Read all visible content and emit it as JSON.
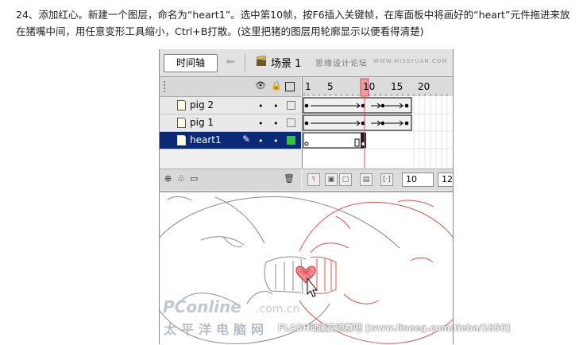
{
  "instruction_text": "24、添加红心。新建一个图层，命名为“heart1”。选中第10帧，按F6插入关键帧，在库面板中将画好的“heart”元件拖进来放在猪嘴中间，用任意变形工具缩小，Ctrl+B打散。(这里把猪的图层用轮廓显示以便看得清楚)",
  "toolbar": {
    "timeline_button": "时间轴",
    "scene_label": "场景 1",
    "forum_text": "思缘设计论坛",
    "site_text": "WWW.MISSYUAN.COM"
  },
  "timeline": {
    "frame_numbers": [
      "1",
      "5",
      "10",
      "15",
      "20"
    ],
    "layers": [
      {
        "name": "pig 2",
        "selected": false,
        "outline_color": "#e05050"
      },
      {
        "name": "pig 1",
        "selected": false,
        "outline_color": "#8a8a8a"
      },
      {
        "name": "heart1",
        "selected": true,
        "outline_color": "#2ec82e"
      }
    ],
    "current_frame": "10",
    "frame_rate": "12"
  },
  "watermark": {
    "brand": "PConline",
    "domain_suffix": ".com.cn",
    "brand_cn": "太平洋电脑网",
    "credit": "FLASH动画交流群吧 [www.lineeg.com/tieba/1856]"
  },
  "colors": {
    "selected_layer": "#0a2a78",
    "playhead": "#e05560",
    "pig_left_outline": "#8a8a8a",
    "pig_right_outline": "#e05050",
    "heart": "#e0202a"
  }
}
